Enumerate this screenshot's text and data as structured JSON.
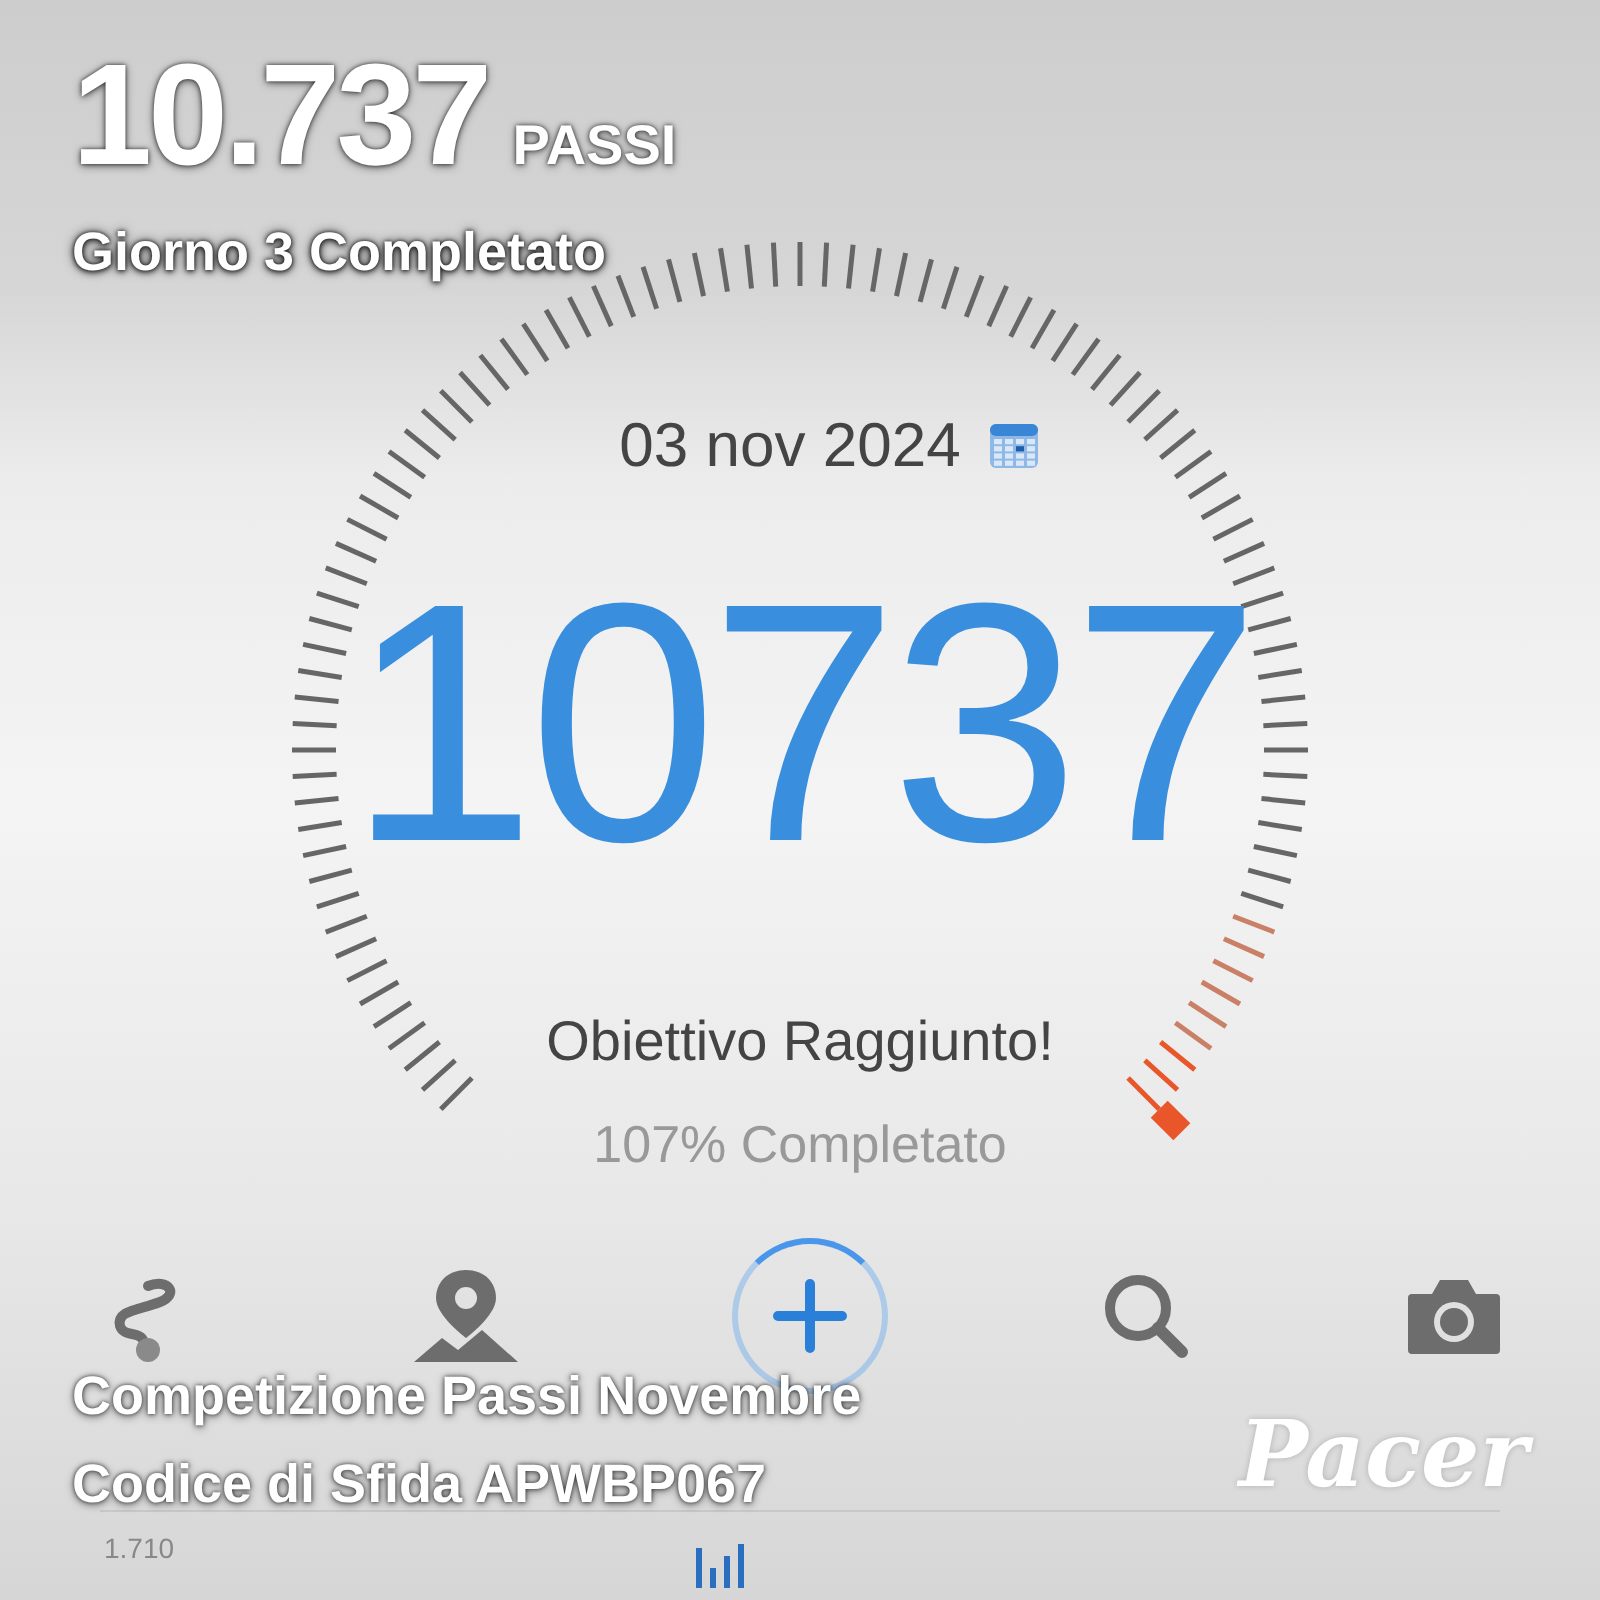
{
  "overlay": {
    "steps": "10.737",
    "steps_unit": "PASSI",
    "day_status": "Giorno 3 Completato",
    "competition": "Competizione Passi Novembre",
    "challenge_code": "Codice di Sfida APWBP067",
    "brand": "Pacer"
  },
  "dial": {
    "date": "03 nov 2024",
    "steps": "10737",
    "message": "Obiettivo Raggiunto!",
    "percent": "107% Completato"
  },
  "toolbar": [
    {
      "kind": "route"
    },
    {
      "kind": "map"
    },
    {
      "kind": "add"
    },
    {
      "kind": "search"
    },
    {
      "kind": "camera"
    }
  ],
  "chart": {
    "axis_label": "1.710"
  }
}
